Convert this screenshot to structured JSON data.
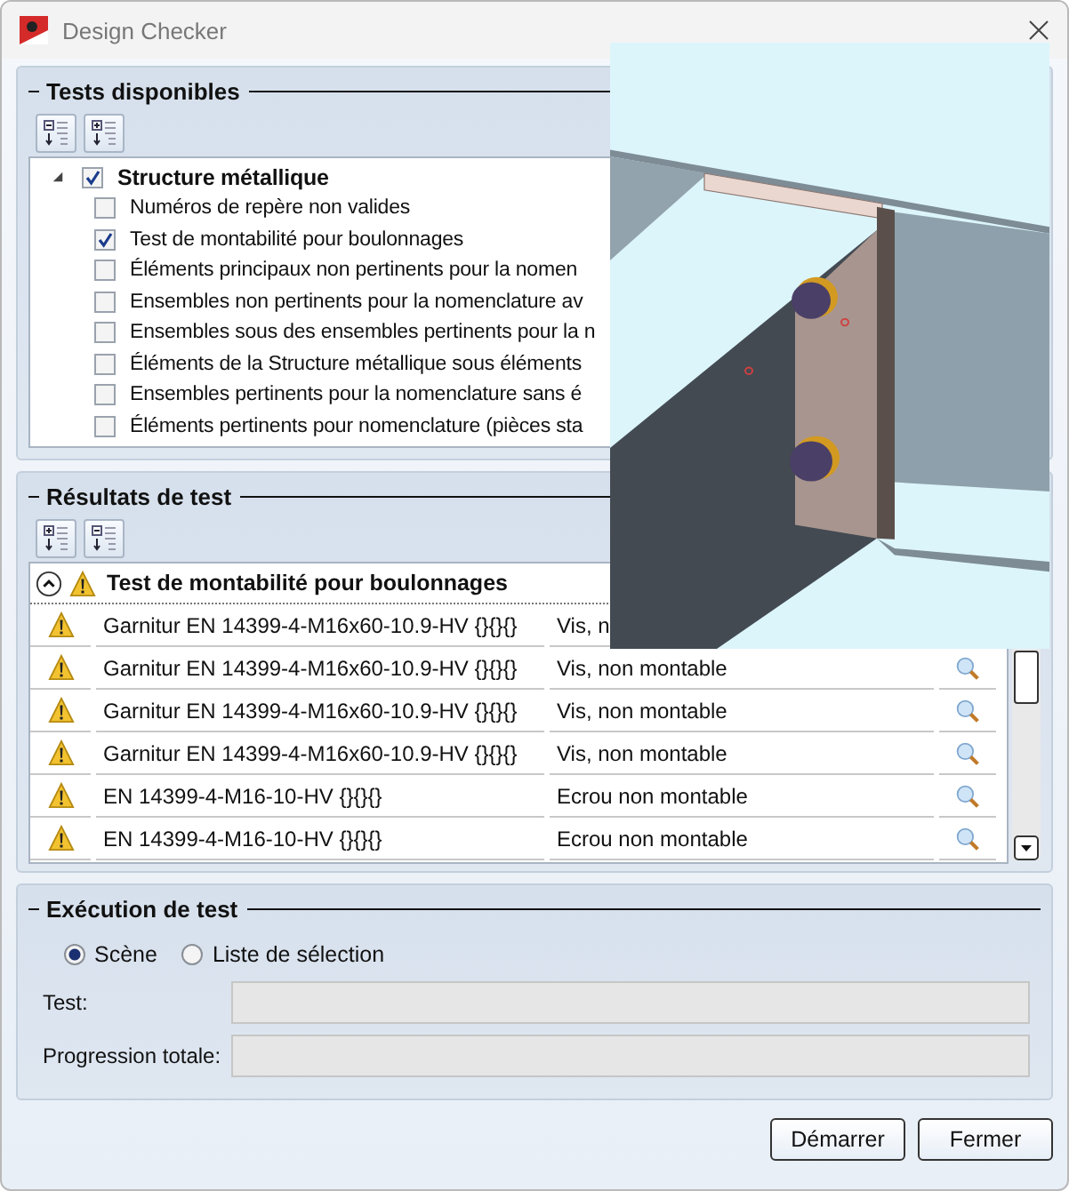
{
  "window": {
    "title": "Design Checker"
  },
  "available_tests": {
    "title": "Tests disponibles",
    "tree": [
      {
        "label": "Structure métallique",
        "checked": true,
        "expanded": true,
        "children": [
          {
            "label": "Numéros de repère non valides",
            "checked": false
          },
          {
            "label": "Test de montabilité pour boulonnages",
            "checked": true
          },
          {
            "label": "Éléments principaux non pertinents pour la nomen",
            "checked": false
          },
          {
            "label": "Ensembles non pertinents pour la nomenclature av",
            "checked": false
          },
          {
            "label": "Ensembles sous des ensembles pertinents pour la n",
            "checked": false
          },
          {
            "label": "Éléments de la Structure métallique sous éléments",
            "checked": false
          },
          {
            "label": "Ensembles pertinents pour la nomenclature sans é",
            "checked": false
          },
          {
            "label": "Éléments pertinents pour nomenclature (pièces sta",
            "checked": false
          }
        ]
      }
    ]
  },
  "results": {
    "title": "Résultats de test",
    "group": {
      "label": "Test de montabilité pour boulonnages",
      "expanded": true
    },
    "rows": [
      {
        "element": "Garnitur EN 14399-4-M16x60-10.9-HV {}{}{}",
        "message": "Vis, n"
      },
      {
        "element": "Garnitur EN 14399-4-M16x60-10.9-HV {}{}{}",
        "message": "Vis, non montable"
      },
      {
        "element": "Garnitur EN 14399-4-M16x60-10.9-HV {}{}{}",
        "message": "Vis, non montable"
      },
      {
        "element": "Garnitur EN 14399-4-M16x60-10.9-HV {}{}{}",
        "message": "Vis, non montable"
      },
      {
        "element": "EN 14399-4-M16-10-HV {}{}{}",
        "message": "Ecrou non montable"
      },
      {
        "element": "EN 14399-4-M16-10-HV {}{}{}",
        "message": "Ecrou non montable"
      }
    ]
  },
  "execution": {
    "title": "Exécution de test",
    "options": [
      {
        "label": "Scène",
        "selected": true
      },
      {
        "label": "Liste de sélection",
        "selected": false
      }
    ],
    "fields": [
      {
        "label": "Test:"
      },
      {
        "label": "Progression totale:"
      }
    ]
  },
  "buttons": [
    "Démarrer",
    "Fermer"
  ]
}
